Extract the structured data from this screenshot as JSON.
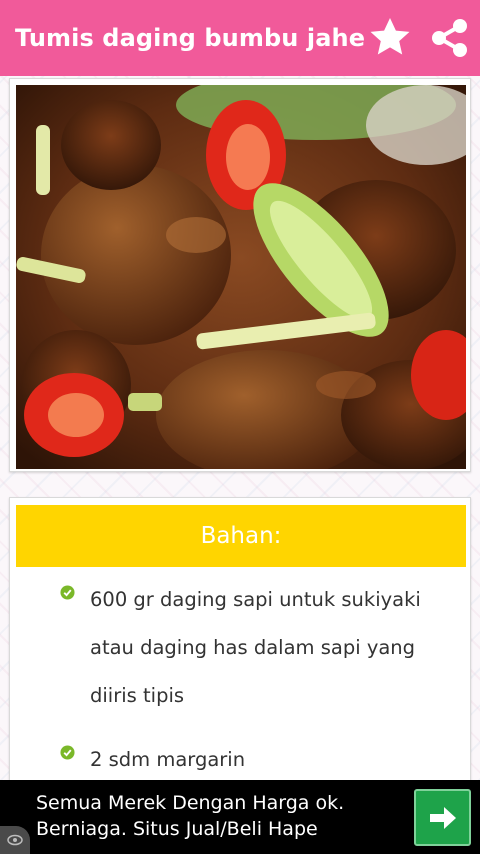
{
  "app_bar": {
    "title": "Tumis daging bumbu jahe",
    "background_color": "#f15a9a",
    "actions": [
      {
        "name": "favorite",
        "icon": "star-icon"
      },
      {
        "name": "share",
        "icon": "share-icon"
      }
    ]
  },
  "photo": {
    "subject": "food-photo",
    "colors": {
      "sauce": "#6b3518",
      "chili": "#e0281a",
      "green_chili": "#b6d866"
    }
  },
  "ingredients": {
    "header": "Bahan:",
    "header_color": "#ffd500",
    "bullet_icon": "check-circle-icon",
    "items": [
      "600 gr daging sapi untuk sukiyaki atau daging has dalam sapi yang diiris tipis",
      "2 sdm margarin"
    ]
  },
  "ad": {
    "line1": "Semua Merek Dengan Harga ok.",
    "line2": "Berniaga. Situs Jual/Beli Hape",
    "button_icon": "arrow-right-icon",
    "button_color": "#1ea34a",
    "info_icon": "ad-choices-icon"
  }
}
